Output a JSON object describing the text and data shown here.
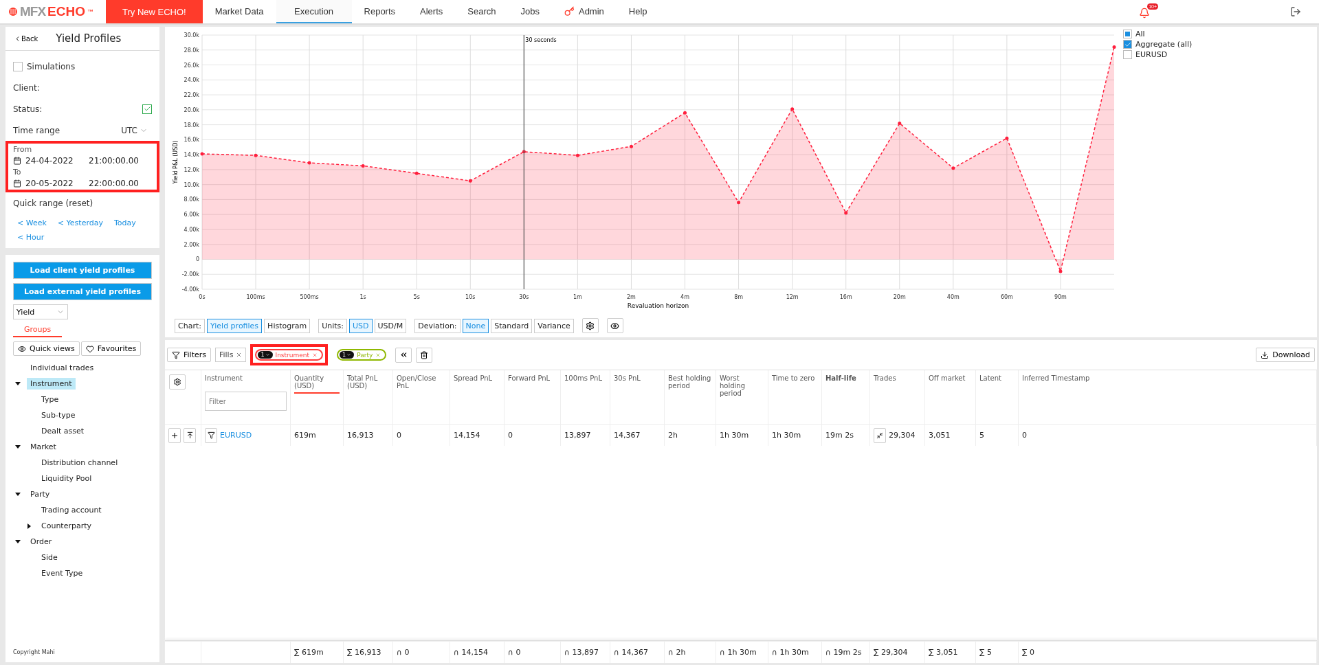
{
  "topbar": {
    "logo": {
      "brand": "MFX",
      "product": "ECHO",
      "mark": "™"
    },
    "promo": "Try New ECHO!",
    "tabs": [
      {
        "label": "Market Data",
        "selected": false
      },
      {
        "label": "Execution",
        "selected": true
      },
      {
        "label": "Reports",
        "selected": false
      },
      {
        "label": "Alerts",
        "selected": false
      },
      {
        "label": "Search",
        "selected": false
      },
      {
        "label": "Jobs",
        "selected": false
      },
      {
        "label": "Admin",
        "selected": false,
        "kind": "admin"
      },
      {
        "label": "Help",
        "selected": false
      }
    ],
    "notifications": "10+"
  },
  "sidebar": {
    "back": "Back",
    "title": "Yield Profiles",
    "simulations": {
      "label": "Simulations",
      "checked": false
    },
    "client": "Client:",
    "status": {
      "label": "Status:",
      "checked": true
    },
    "time_range": {
      "label": "Time range",
      "zone": "UTC"
    },
    "from": {
      "label": "From",
      "date": "24-04-2022",
      "time": "21:00:00.00"
    },
    "to": {
      "label": "To",
      "date": "20-05-2022",
      "time": "22:00:00.00"
    },
    "quick_range": "Quick range (reset)",
    "quick_links": [
      "< Week",
      "< Yesterday",
      "Today",
      "< Hour"
    ],
    "load_buttons": [
      "Load client yield profiles",
      "Load external yield profiles"
    ],
    "metric": "Yield",
    "groups_tab": {
      "label": "Groups",
      "selected": true
    },
    "view_buttons": [
      {
        "label": "Quick views",
        "kind": "eye"
      },
      {
        "label": "Favourites",
        "kind": "heart"
      }
    ],
    "tree": [
      {
        "label": "Individual trades",
        "selected": false
      },
      {
        "label": "Instrument",
        "selected": true,
        "expanded": true,
        "children": [
          {
            "label": "Type",
            "selected": false
          },
          {
            "label": "Sub-type",
            "selected": false
          },
          {
            "label": "Dealt asset",
            "selected": false
          }
        ]
      },
      {
        "label": "Market",
        "selected": false,
        "expanded": true,
        "children": [
          {
            "label": "Distribution channel",
            "selected": false
          },
          {
            "label": "Liquidity Pool",
            "selected": false
          }
        ]
      },
      {
        "label": "Party",
        "selected": false,
        "expanded": true,
        "children": [
          {
            "label": "Trading account",
            "selected": false
          },
          {
            "label": "Counterparty",
            "selected": false,
            "expanded": false
          }
        ]
      },
      {
        "label": "Order",
        "selected": false,
        "expanded": true,
        "children": [
          {
            "label": "Side",
            "selected": false
          },
          {
            "label": "Event Type",
            "selected": false
          }
        ]
      }
    ],
    "copyright": "Copyright Mahi"
  },
  "chart": {
    "legend": [
      {
        "kind": "label",
        "label": "All",
        "checked": false,
        "indeterminate": true
      },
      {
        "kind": "series",
        "checked": true
      },
      {
        "kind": "label",
        "label": "EURUSD",
        "checked": false
      }
    ],
    "chart_data": {
      "type": "area",
      "xlabel": "Revaluation horizon",
      "ylabel": "Yield P&L (USD)",
      "categories": [
        "0s",
        "100ms",
        "500ms",
        "1s",
        "5s",
        "10s",
        "30s",
        "1m",
        "2m",
        "4m",
        "8m",
        "12m",
        "16m",
        "20m",
        "40m",
        "60m",
        "90m",
        null
      ],
      "series": [
        {
          "name": "Aggregate (all)",
          "color": "#ff1f3d",
          "values": [
            14100,
            13900,
            12900,
            12500,
            11500,
            10500,
            14400,
            13900,
            15100,
            19600,
            7600,
            20100,
            6200,
            18200,
            12200,
            16200,
            -1600,
            28400
          ]
        }
      ],
      "ylim": [
        -4000,
        30000
      ],
      "yticks": [
        {
          "value": -4000,
          "label": "-4.00k"
        },
        {
          "value": -2000,
          "label": "-2.00k"
        },
        {
          "value": 0,
          "label": "0"
        },
        {
          "value": 2000,
          "label": "2.00k"
        },
        {
          "value": 4000,
          "label": "4.00k"
        },
        {
          "value": 6000,
          "label": "6.00k"
        },
        {
          "value": 8000,
          "label": "8.00k"
        },
        {
          "value": 10000,
          "label": "10.0k"
        },
        {
          "value": 12000,
          "label": "12.0k"
        },
        {
          "value": 14000,
          "label": "14.0k"
        },
        {
          "value": 16000,
          "label": "16.0k"
        },
        {
          "value": 18000,
          "label": "18.0k"
        },
        {
          "value": 20000,
          "label": "20.0k"
        },
        {
          "value": 22000,
          "label": "22.0k"
        },
        {
          "value": 24000,
          "label": "24.0k"
        },
        {
          "value": 26000,
          "label": "26.0k"
        },
        {
          "value": 28000,
          "label": "28.0k"
        },
        {
          "value": 30000,
          "label": "30.0k"
        }
      ],
      "grid": true,
      "ref_lines": [
        {
          "axis": "x",
          "value": "30s",
          "label": "30 seconds"
        }
      ]
    },
    "controls": [
      {
        "label": "Chart:",
        "options": [
          {
            "label": "Yield profiles",
            "selected": true
          },
          {
            "label": "Histogram",
            "selected": false
          }
        ]
      },
      {
        "label": "Units:",
        "options": [
          {
            "label": "USD",
            "selected": true
          },
          {
            "label": "USD/M",
            "selected": false
          }
        ]
      },
      {
        "label": "Deviation:",
        "options": [
          {
            "label": "None",
            "selected": true
          },
          {
            "label": "Standard",
            "selected": false
          },
          {
            "label": "Variance",
            "selected": false
          }
        ]
      }
    ]
  },
  "filters": {
    "label": "Filters",
    "chips": [
      {
        "label": "Fills",
        "kind": "plain"
      },
      {
        "label": "Instrument",
        "kind": "count",
        "count": "1",
        "color": "#ff3b3b",
        "highlighted": true
      },
      {
        "label": "Party",
        "kind": "count",
        "count": "1",
        "color": "#8fb800",
        "highlighted": false
      }
    ],
    "download": "Download"
  },
  "table": {
    "filter_placeholder": "Filter",
    "columns": [
      {
        "label": "Instrument",
        "sorted": false,
        "bold": false
      },
      {
        "label": "Quantity (USD)",
        "sorted": true,
        "bold": false
      },
      {
        "label": "Total PnL (USD)",
        "sorted": false,
        "bold": false
      },
      {
        "label": "Open/Close PnL",
        "sorted": false,
        "bold": false
      },
      {
        "label": "Spread PnL",
        "sorted": false,
        "bold": false
      },
      {
        "label": "Forward PnL",
        "sorted": false,
        "bold": false
      },
      {
        "label": "100ms PnL",
        "sorted": false,
        "bold": false
      },
      {
        "label": "30s PnL",
        "sorted": false,
        "bold": false
      },
      {
        "label": "Best holding period",
        "sorted": false,
        "bold": false
      },
      {
        "label": "Worst holding period",
        "sorted": false,
        "bold": false
      },
      {
        "label": "Time to zero",
        "sorted": false,
        "bold": false
      },
      {
        "label": "Half-life",
        "sorted": false,
        "bold": true
      },
      {
        "label": "Trades",
        "sorted": false,
        "bold": false
      },
      {
        "label": "Off market",
        "sorted": false,
        "bold": false
      },
      {
        "label": "Latent",
        "sorted": false,
        "bold": false
      },
      {
        "label": "Inferred Timestamp",
        "sorted": false,
        "bold": false
      }
    ],
    "rows": [
      {
        "cells": [
          "EURUSD",
          "619m",
          "16,913",
          "0",
          "14,154",
          "0",
          "13,897",
          "14,367",
          "2h",
          "1h 30m",
          "1h 30m",
          "19m 2s",
          "29,304",
          "3,051",
          "5",
          "0"
        ]
      }
    ],
    "totals": [
      "∑ 619m",
      "∑ 16,913",
      "∩ 0",
      "∩ 14,154",
      "∩ 0",
      "∩ 13,897",
      "∩ 14,367",
      "∩ 2h",
      "∩ 1h 30m",
      "∩ 1h 30m",
      "∩ 19m 2s",
      "∑ 29,304",
      "∑ 3,051",
      "∑ 5",
      "∑ 0"
    ]
  }
}
